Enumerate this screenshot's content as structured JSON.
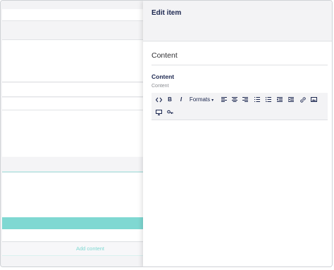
{
  "background_editor": {
    "add_content_label": "Add content",
    "accent_color": "#7fd8d2"
  },
  "panel": {
    "title": "Edit item",
    "section_title": "Content",
    "field": {
      "label": "Content",
      "description": "Content"
    },
    "toolbar": {
      "buttons": [
        {
          "icon": "code-icon"
        },
        {
          "icon": "bold-icon",
          "label": "B"
        },
        {
          "icon": "italic-icon",
          "label": "I"
        },
        {
          "icon": "formats-dropdown",
          "label": "Formats"
        },
        {
          "icon": "align-left-icon"
        },
        {
          "icon": "align-center-icon"
        },
        {
          "icon": "align-right-icon"
        },
        {
          "icon": "bullet-list-icon"
        },
        {
          "icon": "numbered-list-icon"
        },
        {
          "icon": "outdent-icon"
        },
        {
          "icon": "indent-icon"
        },
        {
          "icon": "link-icon"
        },
        {
          "icon": "image-icon"
        },
        {
          "icon": "media-icon"
        },
        {
          "icon": "macro-icon"
        }
      ]
    }
  }
}
